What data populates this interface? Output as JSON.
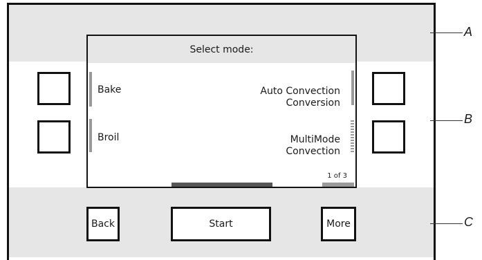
{
  "screen": {
    "title": "Select mode:",
    "options_left": [
      "Bake",
      "Broil"
    ],
    "options_right": [
      [
        "Auto Convection",
        "Conversion"
      ],
      [
        "MultiMode",
        "Convection"
      ]
    ],
    "page_indicator": "1 of 3"
  },
  "buttons": {
    "back": "Back",
    "start": "Start",
    "more": "More"
  },
  "callouts": [
    "A",
    "B",
    "C"
  ]
}
